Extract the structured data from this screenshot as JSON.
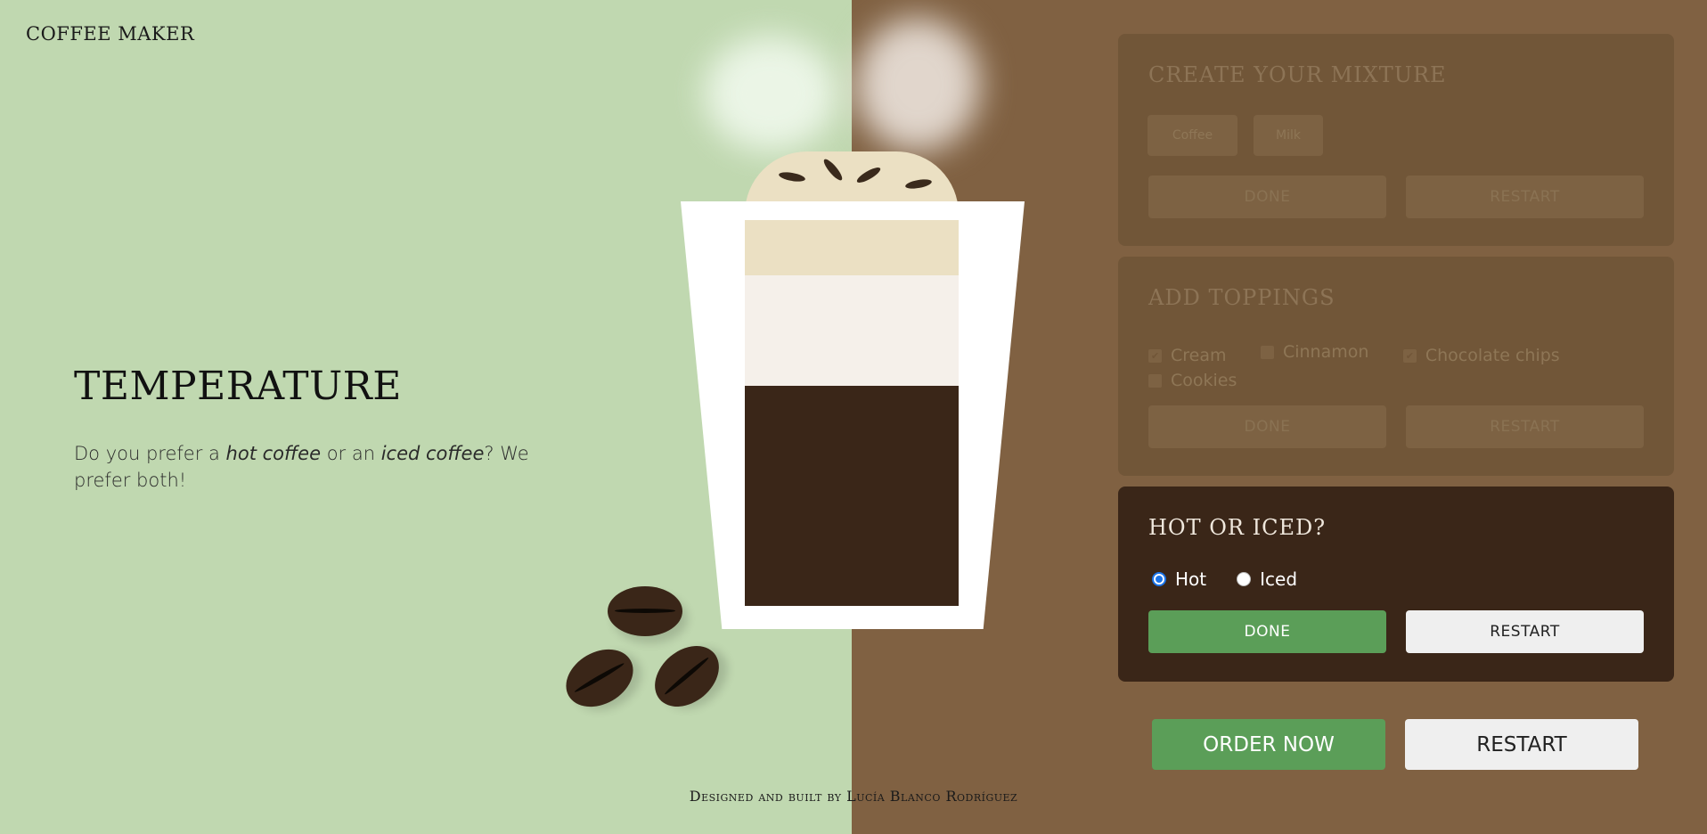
{
  "app": {
    "brand": "COFFEE MAKER",
    "footer": "Designed and built by Lucía Blanco Rodríguez"
  },
  "step": {
    "title": "TEMPERATURE",
    "desc_part1": "Do you prefer a ",
    "desc_em1": "hot coffee",
    "desc_part2": " or an ",
    "desc_em2": "iced coffee",
    "desc_part3": "? We prefer both!"
  },
  "mixture_panel": {
    "title": "CREATE YOUR MIXTURE",
    "chip1": "Coffee",
    "chip2": "Milk",
    "done_label": "DONE",
    "restart_label": "RESTART"
  },
  "toppings_panel": {
    "title": "ADD TOPPINGS",
    "options": [
      {
        "label": "Cream",
        "checked": true
      },
      {
        "label": "Cinnamon",
        "checked": false
      },
      {
        "label": "Chocolate chips",
        "checked": true
      },
      {
        "label": "Cookies",
        "checked": false
      }
    ],
    "done_label": "DONE",
    "restart_label": "RESTART"
  },
  "temperature_panel": {
    "title": "HOT OR ICED?",
    "options": [
      {
        "label": "Hot",
        "selected": true
      },
      {
        "label": "Iced",
        "selected": false
      }
    ],
    "done_label": "DONE",
    "restart_label": "RESTART"
  },
  "actions": {
    "order_label": "ORDER NOW",
    "restart_label": "RESTART"
  },
  "colors": {
    "left_bg": "#c0d8b0",
    "right_bg": "#806142",
    "panel_active": "#3a2618",
    "done_green": "#5b9e58"
  }
}
